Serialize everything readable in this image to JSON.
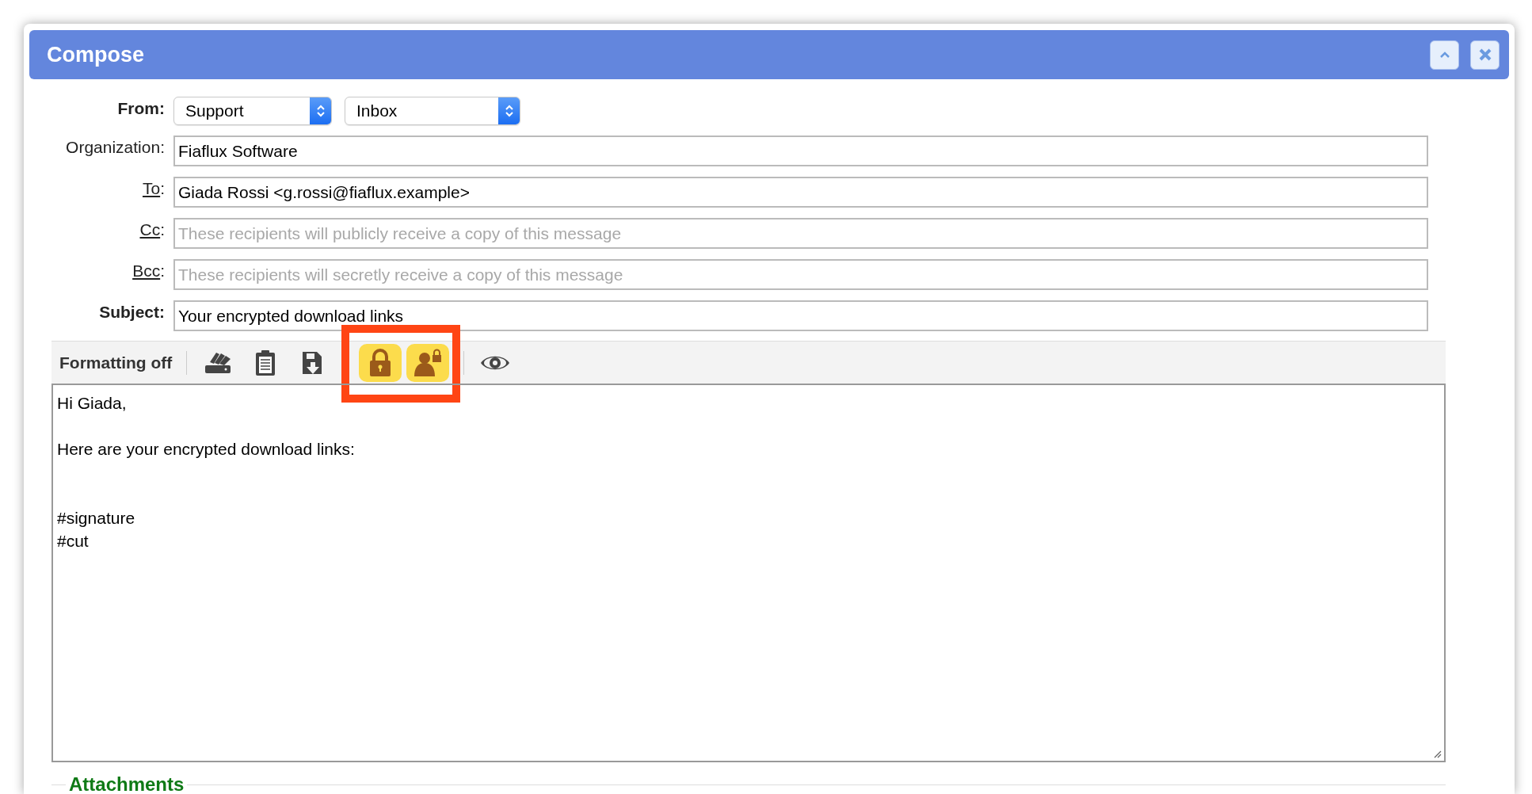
{
  "window": {
    "title": "Compose"
  },
  "header_fields": [
    {
      "kind": "sender",
      "label": "From",
      "suffix": ":",
      "selects": [
        {
          "value": "Support"
        },
        {
          "value": "Inbox"
        }
      ]
    },
    {
      "kind": "text",
      "label": "Organization",
      "suffix": ":",
      "value": "Fiaflux Software"
    },
    {
      "kind": "recipient",
      "label": "To",
      "suffix": ":",
      "value": "Giada Rossi <g.rossi@fiaflux.example>"
    },
    {
      "kind": "recipient",
      "label": "Cc",
      "suffix": ":",
      "placeholder": "These recipients will publicly receive a copy of this message"
    },
    {
      "kind": "recipient",
      "label": "Bcc",
      "suffix": ":",
      "placeholder": "These recipients will secretly receive a copy of this message"
    },
    {
      "kind": "subject",
      "label": "Subject",
      "suffix": ":",
      "value": "Your encrypted download links"
    }
  ],
  "toolbar": {
    "mode_label": "Formatting off",
    "groups": [
      {
        "highlighted": false,
        "tools": [
          {
            "kind": "cards",
            "on": false
          },
          {
            "kind": "clipboard",
            "on": false
          },
          {
            "kind": "save",
            "on": false
          }
        ]
      },
      {
        "highlighted": true,
        "tools": [
          {
            "kind": "lock",
            "on": true
          },
          {
            "kind": "user-lock",
            "on": true
          }
        ]
      },
      {
        "highlighted": false,
        "tools": [
          {
            "kind": "eye",
            "on": false
          }
        ]
      }
    ]
  },
  "body": {
    "text": "Hi Giada,\n\nHere are your encrypted download links:\n\n\n#signature\n#cut"
  },
  "attachments": {
    "title": "Attachments"
  }
}
